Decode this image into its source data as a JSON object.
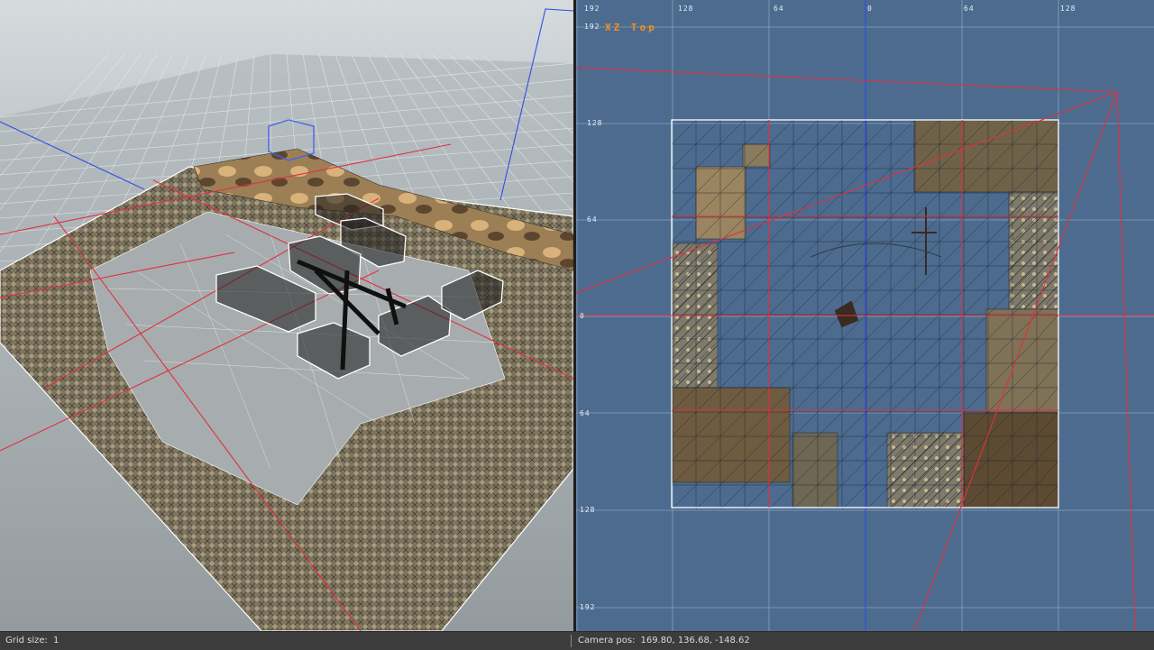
{
  "perspective_view": {
    "colors": {
      "terrain": "#8b8168",
      "grid": "#e8ecef",
      "red_lines": "#e03040",
      "blue_lines": "#3050e0"
    }
  },
  "top_view": {
    "label": "XZ Top",
    "ticks_x": [
      "192",
      "128",
      "64",
      "0",
      "64",
      "128"
    ],
    "ticks_y": [
      "192",
      "128",
      "64",
      "0",
      "64",
      "128",
      "192"
    ],
    "colors": {
      "background": "#4c6b8f",
      "grid": "#8aa0bd",
      "red_lines": "#e03040",
      "label": "#ff8c1a"
    }
  },
  "statusbar": {
    "grid_label": "Grid size:",
    "grid_value": "1",
    "camera_label": "Camera pos:",
    "camera_value": "169.80, 136.68, -148.62"
  }
}
